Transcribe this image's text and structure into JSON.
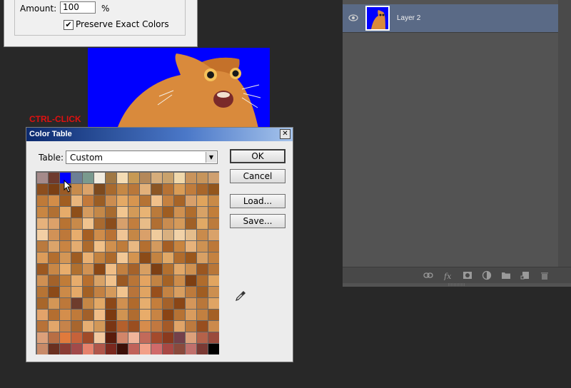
{
  "top_dialog": {
    "amount_label": "Amount:",
    "amount_value": "100",
    "amount_unit": "%",
    "preserve_checked": true,
    "preserve_label": "Preserve Exact Colors"
  },
  "annotation": {
    "ctrl_click": "CTRL-CLICK"
  },
  "color_table": {
    "title": "Color Table",
    "close": "✕",
    "table_label": "Table:",
    "table_value": "Custom",
    "buttons": {
      "ok": "OK",
      "cancel": "Cancel",
      "load": "Load...",
      "save": "Save..."
    },
    "swatches": [
      "#a58a8a",
      "#6e3a2e",
      "#0000ff",
      "#6c7f95",
      "#7a9a8e",
      "#f1ece0",
      "#a07844",
      "#f4dcb4",
      "#c79a55",
      "#b4885a",
      "#d6ad7b",
      "#c9a26c",
      "#f0d8ab",
      "#c9945c",
      "#c7955b",
      "#cfa070",
      "#8c4e1e",
      "#7a3f14",
      "#9a5a24",
      "#c78b4c",
      "#dba36a",
      "#7d4a1e",
      "#a86a2e",
      "#c58845",
      "#b9773a",
      "#e2b07a",
      "#8c5624",
      "#b67234",
      "#d99c56",
      "#c07c3c",
      "#a8662a",
      "#93561d",
      "#bf7a38",
      "#d38d48",
      "#a15e22",
      "#e9b57c",
      "#c3793a",
      "#9a5d24",
      "#cc8d50",
      "#e4a965",
      "#d7954f",
      "#b57334",
      "#f0c08a",
      "#c58140",
      "#a76427",
      "#d8a06a",
      "#e0a45c",
      "#c98a47",
      "#c98642",
      "#b17033",
      "#e6ab6a",
      "#8e4f19",
      "#d59b5e",
      "#c48848",
      "#a86b2f",
      "#f2c690",
      "#d39a58",
      "#e8b374",
      "#ba7a3b",
      "#9f5d21",
      "#cf9050",
      "#b06d2d",
      "#d8a266",
      "#c27e3a",
      "#e6b27c",
      "#dca16a",
      "#b87332",
      "#c88a4a",
      "#f0c38e",
      "#a96a30",
      "#8b4d1c",
      "#d7a06c",
      "#c27e3e",
      "#e8bc88",
      "#b16f33",
      "#c98c50",
      "#d59a5a",
      "#a06026",
      "#e1a965",
      "#bc7b3c",
      "#f3cfa4",
      "#d19257",
      "#bd783a",
      "#e7ad6d",
      "#a65f22",
      "#cf8c4a",
      "#b97234",
      "#f0c595",
      "#c58746",
      "#d9a06a",
      "#efcb9c",
      "#d8b080",
      "#f1d2a8",
      "#e4bd8c",
      "#c98b4c",
      "#d9a26a",
      "#ba7a3e",
      "#dca46a",
      "#c98442",
      "#e4ac70",
      "#ad6a2c",
      "#f0c088",
      "#d0904e",
      "#bf7c3a",
      "#e9b882",
      "#b46f30",
      "#d39a5e",
      "#a55e24",
      "#c8843f",
      "#e7b27a",
      "#ce9252",
      "#bc7838",
      "#dc9c5a",
      "#b36e2e",
      "#d39656",
      "#9e5c22",
      "#e9b072",
      "#c3823f",
      "#ad6a2b",
      "#f2c896",
      "#d4944f",
      "#8b4b18",
      "#c38341",
      "#e0a866",
      "#b06c2d",
      "#9a571c",
      "#d8a064",
      "#c48240",
      "#9c5820",
      "#c88746",
      "#e8ad6c",
      "#b07030",
      "#d19253",
      "#8a4715",
      "#f0be86",
      "#c28040",
      "#a5622a",
      "#d89f62",
      "#7d4014",
      "#b3702f",
      "#e2a868",
      "#cf9150",
      "#9a5620",
      "#b87638",
      "#d09052",
      "#a3622a",
      "#c07c38",
      "#e7ac6c",
      "#b86f2e",
      "#d8a266",
      "#f1c28c",
      "#9b5922",
      "#b97537",
      "#e4a461",
      "#c28343",
      "#a56224",
      "#cd8c4a",
      "#7e3f12",
      "#b06c2c",
      "#e1a560",
      "#b77434",
      "#8c4a18",
      "#cc8a48",
      "#e5a968",
      "#a36024",
      "#c38142",
      "#d59a5b",
      "#f2c48e",
      "#b8743a",
      "#e0a462",
      "#984f1c",
      "#c48343",
      "#d89e60",
      "#bd7a3c",
      "#a05d22",
      "#cc8f50",
      "#a8662a",
      "#d39656",
      "#bd783a",
      "#6e3c2c",
      "#c58746",
      "#e2a866",
      "#8c4818",
      "#d09050",
      "#b06a2c",
      "#e6ae6e",
      "#c47e3c",
      "#a4612a",
      "#8a4616",
      "#d4965a",
      "#b9773a",
      "#dfa464",
      "#e3a36a",
      "#b46e30",
      "#d48e4c",
      "#c07a3a",
      "#a2602a",
      "#f0bc86",
      "#7c3a10",
      "#d09452",
      "#b06c30",
      "#e8ac6a",
      "#c88444",
      "#8a4414",
      "#b67234",
      "#d99c5e",
      "#c28040",
      "#a46024",
      "#b87238",
      "#e2a66a",
      "#c6834a",
      "#a8662e",
      "#e6ae72",
      "#d29858",
      "#7a3614",
      "#b4602c",
      "#9a4e20",
      "#d68c4c",
      "#c27840",
      "#a45a28",
      "#e0a468",
      "#bd7a3e",
      "#984e1e",
      "#cc8a4c",
      "#dca07a",
      "#b86e44",
      "#e07a3c",
      "#c6623a",
      "#a04a28",
      "#f2c8a0",
      "#5a1c0c",
      "#d2866a",
      "#f0b49a",
      "#c26a5a",
      "#a44a2c",
      "#8a3a1e",
      "#74404a",
      "#dca07a",
      "#b4624a",
      "#9a4a3c",
      "#c88a68",
      "#6a3020",
      "#8a3c34",
      "#a24a4a",
      "#e6826c",
      "#b0564a",
      "#7a281e",
      "#3c1008",
      "#c0625a",
      "#f2a088",
      "#d06a6a",
      "#a84844",
      "#8a4a3c",
      "#c0706c",
      "#7a3a34",
      "#000000"
    ]
  },
  "layers_panel": {
    "layer_name": "Layer 2"
  }
}
